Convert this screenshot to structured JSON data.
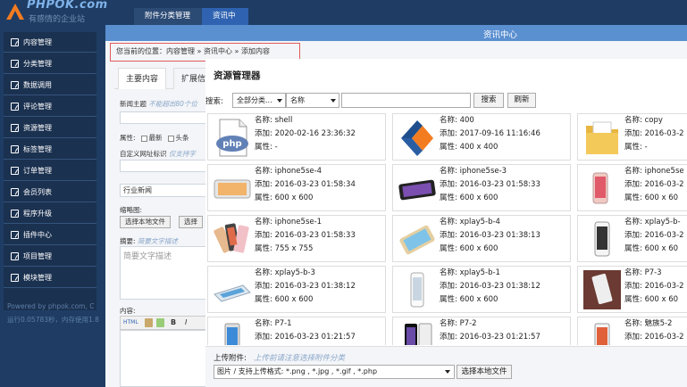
{
  "logo": {
    "name": "PHPOK.com",
    "slogan": "有感情的企业站"
  },
  "topnav": {
    "items": [
      "附件分类管理",
      "资讯中心"
    ]
  },
  "sidebar": {
    "items": [
      "内容管理",
      "分类管理",
      "数据调用",
      "评论管理",
      "资源管理",
      "标签管理",
      "订单管理",
      "会员列表",
      "程序升级",
      "插件中心",
      "项目管理",
      "模块管理"
    ],
    "footer_line1": "Powered by phpok.com, C",
    "footer_line2": "运行0.05783秒，内存使用1.8"
  },
  "page": {
    "strip_title": "资讯中心",
    "breadcrumb": "您当前的位置：内容管理 » 资讯中心 » 添加内容",
    "tabs": [
      "主要内容",
      "扩展信"
    ],
    "form": {
      "title_label": "新闻主题",
      "title_hint": "不能超出80个位",
      "attr_label": "属性:",
      "attr_new": "最新",
      "attr_head": "头条",
      "url_label": "自定义网址标识",
      "url_hint": "仅支持字",
      "category_value": "行业新闻",
      "thumb_label": "缩略图:",
      "thumb_btn1": "选择本地文件",
      "thumb_btn2": "选择",
      "summary_label": "摘要:",
      "summary_hint": "简要文字描述",
      "summary_placeholder": "简要文字描述",
      "content_label": "内容:",
      "editor_html": "HTML",
      "editor_b": "B",
      "editor_i": "I"
    }
  },
  "resource_manager": {
    "title": "资源管理器",
    "search_label": "搜索:",
    "category_select": "全部分类...",
    "field_select": "名称",
    "search_btn": "搜索",
    "refresh_btn": "刷新",
    "k_name": "名称:",
    "k_added": "添加:",
    "k_attr": "属性:",
    "items": [
      {
        "name": "shell",
        "added": "2020-02-16 23:36:32",
        "attr": "-",
        "icon": "php-file-icon"
      },
      {
        "name": "400",
        "added": "2017-09-16 11:16:46",
        "attr": "400 x 400",
        "icon": "phpok-logo-icon"
      },
      {
        "name": "copy",
        "added": "2016-03-2",
        "attr": "-",
        "icon": "folder-icon"
      },
      {
        "name": "iphone5se-4",
        "added": "2016-03-23 01:58:34",
        "attr": "600 x 600",
        "icon": "phone-lying-icon"
      },
      {
        "name": "iphone5se-3",
        "added": "2016-03-23 01:58:33",
        "attr": "600 x 600",
        "icon": "phone-lying-dark-icon"
      },
      {
        "name": "iphone5se",
        "added": "2016-03-2",
        "attr": "600 x 60",
        "icon": "phone-standing-icon"
      },
      {
        "name": "iphone5se-1",
        "added": "2016-03-23 01:58:33",
        "attr": "755 x 755",
        "icon": "phone-fan-icon"
      },
      {
        "name": "xplay5-b-4",
        "added": "2016-03-23 01:38:13",
        "attr": "600 x 600",
        "icon": "phone-gold-icon"
      },
      {
        "name": "xplay5-b-",
        "added": "2016-03-2",
        "attr": "600 x 60",
        "icon": "phone-front-icon"
      },
      {
        "name": "xplay5-b-3",
        "added": "2016-03-23 01:38:12",
        "attr": "600 x 600",
        "icon": "phone-flat-icon"
      },
      {
        "name": "xplay5-b-1",
        "added": "2016-03-23 01:38:12",
        "attr": "600 x 600",
        "icon": "phone-white-icon"
      },
      {
        "name": "P7-3",
        "added": "2016-03-2",
        "attr": "600 x 60",
        "icon": "phone-photo-icon"
      },
      {
        "name": "P7-1",
        "added": "2016-03-23 01:21:57",
        "attr": "",
        "icon": "phone-blue-icon"
      },
      {
        "name": "P7-2",
        "added": "2016-03-23 01:21:57",
        "attr": "",
        "icon": "phone-black-icon"
      },
      {
        "name": "魅族5-2",
        "added": "2016-03-2",
        "attr": "",
        "icon": "phone-meizu-icon"
      }
    ],
    "upload_label": "上传附件:",
    "upload_hint": "上传前请注意选择附件分类",
    "type_select": "图片 / 支持上传格式: *.png , *.jpg , *.gif , *.php",
    "local_btn": "选择本地文件"
  }
}
